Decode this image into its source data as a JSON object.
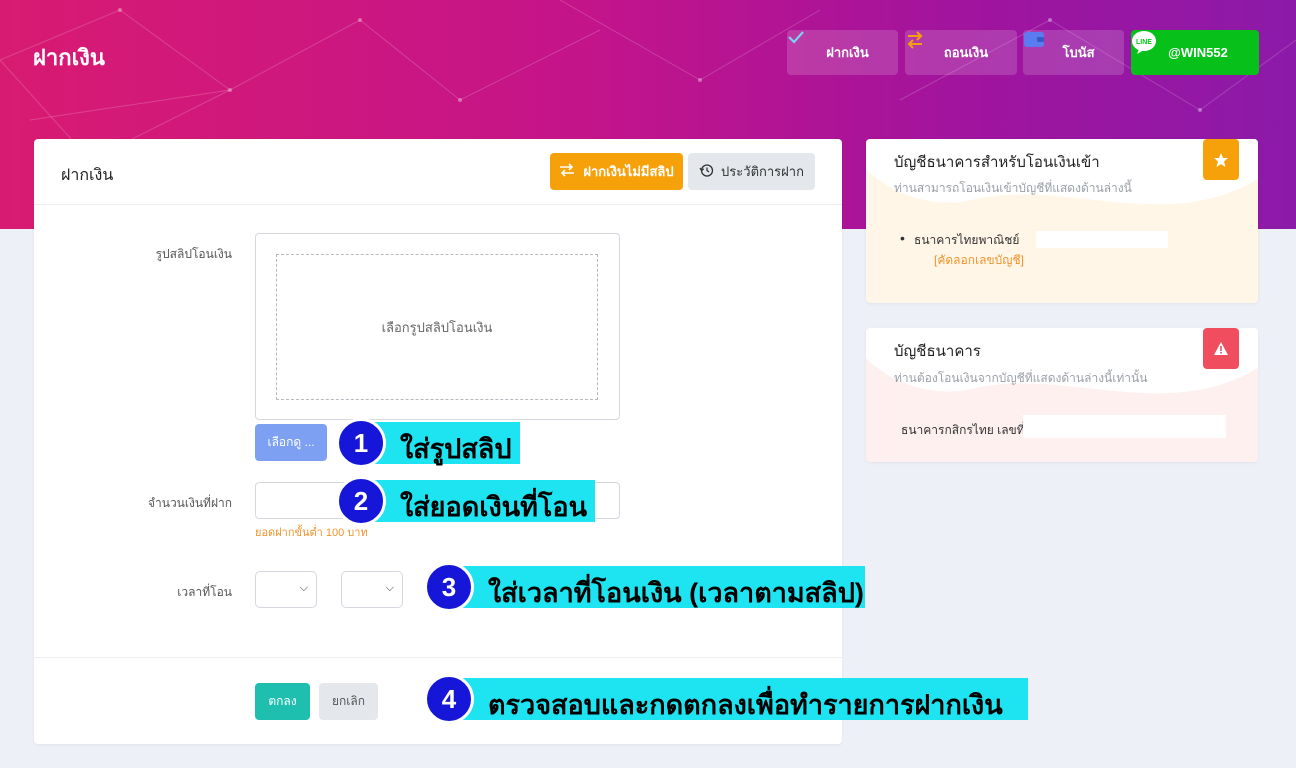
{
  "header": {
    "page_title": "ฝากเงิน",
    "buttons": [
      {
        "label": "ฝากเงิน",
        "icon": "check-icon"
      },
      {
        "label": "ถอนเงิน",
        "icon": "swap-icon"
      },
      {
        "label": "โบนัส",
        "icon": "wallet-icon"
      },
      {
        "label": "@WIN552",
        "icon": "line-icon",
        "icon_text": "LINE"
      }
    ]
  },
  "form": {
    "title": "ฝากเงิน",
    "deposit_no_slip_label": "ฝากเงินไม่มีสลิป",
    "history_label": "ประวัติการฝาก",
    "slip_label": "รูปสลิปโอนเงิน",
    "slip_placeholder": "เลือกรูปสลิปโอนเงิน",
    "browse_label": "เลือกดู ...",
    "amount_label": "จำนวนเงินที่ฝาก",
    "amount_value": "",
    "amount_hint": "ยอดฝากขั้นต่ำ 100 บาท",
    "time_label": "เวลาที่โอน",
    "submit_label": "ตกลง",
    "cancel_label": "ยกเลิก"
  },
  "receive_account": {
    "title": "บัญชีธนาคารสำหรับโอนเงินเข้า",
    "subtitle": "ท่านสามารถโอนเงินเข้าบัญชีที่แสดงด้านล่างนี้",
    "bank_name": "ธนาคารไทยพาณิชย์",
    "copy_label": "[คัดลอกเลขบัญชี]"
  },
  "sender_account": {
    "title": "บัญชีธนาคาร",
    "subtitle": "ท่านต้องโอนเงินจากบัญชีที่แสดงด้านล่างนี้เท่านั้น",
    "bank_line": "ธนาคารกสิกรไทย เลขที่:"
  },
  "steps": [
    {
      "num": "1",
      "text": "ใส่รูปสลิป"
    },
    {
      "num": "2",
      "text": "ใส่ยอดเงินที่โอน"
    },
    {
      "num": "3",
      "text": "ใส่เวลาที่โอนเงิน (เวลาตามสลิป)"
    },
    {
      "num": "4",
      "text": "ตรวจสอบและกดตกลงเพื่อทำรายการฝากเงิน"
    }
  ],
  "colors": {
    "hero_start": "#d81b72",
    "hero_end": "#8c1aa8",
    "orange": "#f7a10a",
    "teal": "#1fbfb0",
    "line_green": "#07c11a",
    "annotation_cyan": "#1ee3f0",
    "annotation_blue": "#1616d8"
  }
}
